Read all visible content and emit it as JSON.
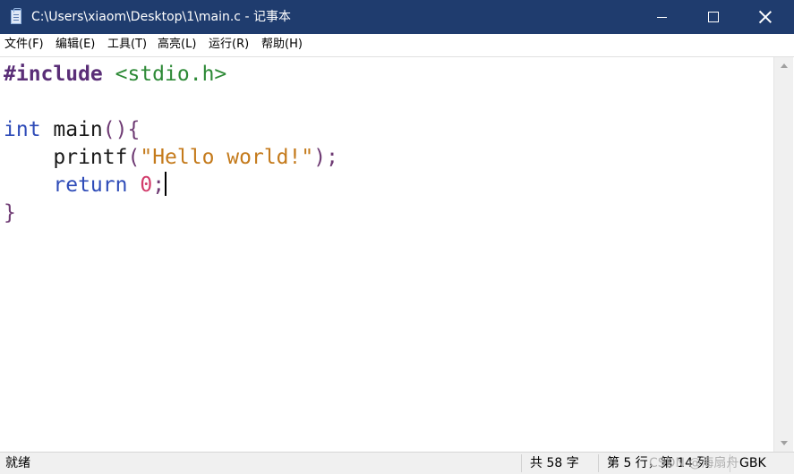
{
  "window": {
    "title": "C:\\Users\\xiaom\\Desktop\\1\\main.c - 记事本",
    "icon": "notepad-icon",
    "controls": {
      "minimize": "minimize-icon",
      "maximize": "maximize-icon",
      "close": "close-icon"
    }
  },
  "menubar": {
    "items": [
      "文件(F)",
      "编辑(E)",
      "工具(T)",
      "高亮(L)",
      "运行(R)",
      "帮助(H)"
    ]
  },
  "editor": {
    "lines": [
      [
        {
          "text": "#include",
          "kind": "preprocessor"
        },
        {
          "text": " ",
          "kind": "plain"
        },
        {
          "text": "<stdio.h>",
          "kind": "include-path"
        }
      ],
      [],
      [
        {
          "text": "int",
          "kind": "type"
        },
        {
          "text": " main",
          "kind": "plain"
        },
        {
          "text": "(){",
          "kind": "bracket"
        }
      ],
      [
        {
          "text": "    printf",
          "kind": "plain"
        },
        {
          "text": "(",
          "kind": "bracket"
        },
        {
          "text": "\"Hello world!\"",
          "kind": "string"
        },
        {
          "text": ");",
          "kind": "bracket"
        }
      ],
      [
        {
          "text": "    return",
          "kind": "keyword"
        },
        {
          "text": " ",
          "kind": "plain"
        },
        {
          "text": "0",
          "kind": "number"
        },
        {
          "text": ";",
          "kind": "bracket"
        }
      ],
      [
        {
          "text": "}",
          "kind": "bracket"
        }
      ]
    ],
    "caret_line": 5,
    "colors": {
      "preprocessor": "#5a2e77",
      "type": "#2f4cb8",
      "keyword": "#2f4cb8",
      "string": "#c47a1b",
      "number": "#d23a6a",
      "include_path": "#2e8a37",
      "bracket": "#6e3a73"
    }
  },
  "statusbar": {
    "state": "就绪",
    "char_count": "共 58 字",
    "position": "第 5 行，第 14 列",
    "encoding": "GBK",
    "watermark": "CSDN @海扇舟"
  }
}
